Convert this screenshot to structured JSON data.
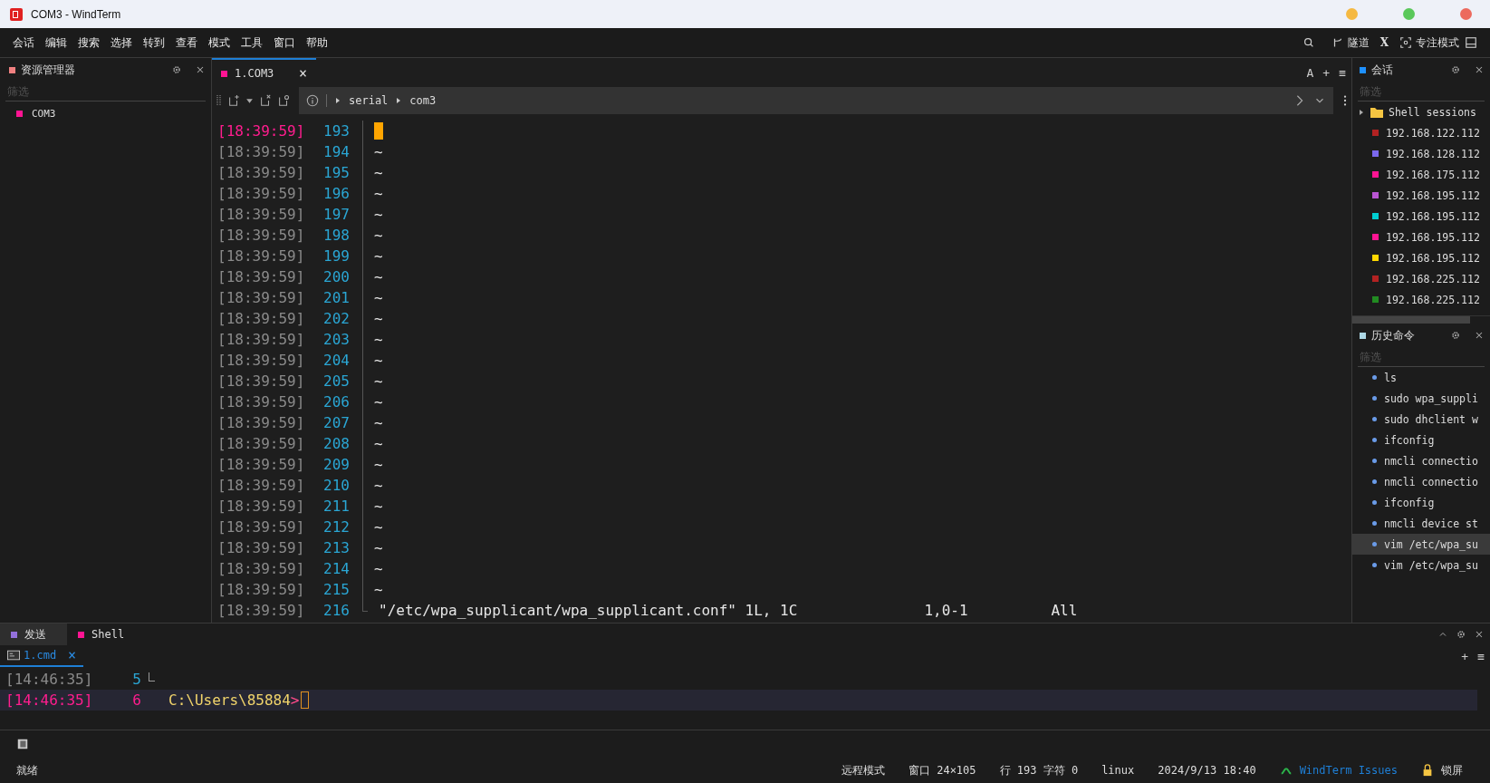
{
  "window": {
    "title": "COM3 - WindTerm"
  },
  "menu": [
    "会话",
    "编辑",
    "搜索",
    "选择",
    "转到",
    "查看",
    "模式",
    "工具",
    "窗口",
    "帮助"
  ],
  "menu_right": {
    "tunnel": "隧道",
    "x": "X",
    "focus": "专注模式"
  },
  "explorer": {
    "title": "资源管理器",
    "filter_placeholder": "筛选",
    "items": [
      {
        "label": "COM3",
        "color": "#ff1493"
      }
    ]
  },
  "editor_tabs": [
    {
      "label": "1.COM3",
      "selected": true,
      "color": "#ff1493",
      "close": "×"
    }
  ],
  "editor_actions": {
    "font": "A",
    "add": "+",
    "menu": "≡"
  },
  "breadcrumbs": [
    "serial",
    "com3"
  ],
  "terminal": {
    "rows": [
      {
        "time": "[18:39:59]",
        "num": "193",
        "text": "",
        "current": true
      },
      {
        "time": "[18:39:59]",
        "num": "194",
        "text": "~",
        "current": false
      },
      {
        "time": "[18:39:59]",
        "num": "195",
        "text": "~",
        "current": false
      },
      {
        "time": "[18:39:59]",
        "num": "196",
        "text": "~",
        "current": false
      },
      {
        "time": "[18:39:59]",
        "num": "197",
        "text": "~",
        "current": false
      },
      {
        "time": "[18:39:59]",
        "num": "198",
        "text": "~",
        "current": false
      },
      {
        "time": "[18:39:59]",
        "num": "199",
        "text": "~",
        "current": false
      },
      {
        "time": "[18:39:59]",
        "num": "200",
        "text": "~",
        "current": false
      },
      {
        "time": "[18:39:59]",
        "num": "201",
        "text": "~",
        "current": false
      },
      {
        "time": "[18:39:59]",
        "num": "202",
        "text": "~",
        "current": false
      },
      {
        "time": "[18:39:59]",
        "num": "203",
        "text": "~",
        "current": false
      },
      {
        "time": "[18:39:59]",
        "num": "204",
        "text": "~",
        "current": false
      },
      {
        "time": "[18:39:59]",
        "num": "205",
        "text": "~",
        "current": false
      },
      {
        "time": "[18:39:59]",
        "num": "206",
        "text": "~",
        "current": false
      },
      {
        "time": "[18:39:59]",
        "num": "207",
        "text": "~",
        "current": false
      },
      {
        "time": "[18:39:59]",
        "num": "208",
        "text": "~",
        "current": false
      },
      {
        "time": "[18:39:59]",
        "num": "209",
        "text": "~",
        "current": false
      },
      {
        "time": "[18:39:59]",
        "num": "210",
        "text": "~",
        "current": false
      },
      {
        "time": "[18:39:59]",
        "num": "211",
        "text": "~",
        "current": false
      },
      {
        "time": "[18:39:59]",
        "num": "212",
        "text": "~",
        "current": false
      },
      {
        "time": "[18:39:59]",
        "num": "213",
        "text": "~",
        "current": false
      },
      {
        "time": "[18:39:59]",
        "num": "214",
        "text": "~",
        "current": false
      },
      {
        "time": "[18:39:59]",
        "num": "215",
        "text": "~",
        "current": false
      },
      {
        "time": "[18:39:59]",
        "num": "216",
        "text": "\"/etc/wpa_supplicant/wpa_supplicant.conf\" 1L, 1C",
        "pos": "1,0-1",
        "scroll": "All",
        "current": false
      }
    ]
  },
  "sessions": {
    "title": "会话",
    "filter_placeholder": "筛选",
    "folder": {
      "label": "Shell sessions",
      "expanded": false
    },
    "items": [
      {
        "label": "192.168.122.112",
        "color": "#b22222"
      },
      {
        "label": "192.168.128.112",
        "color": "#7b68ee"
      },
      {
        "label": "192.168.175.112",
        "color": "#ff1493"
      },
      {
        "label": "192.168.195.112",
        "color": "#ba55d3"
      },
      {
        "label": "192.168.195.112",
        "color": "#00ced1"
      },
      {
        "label": "192.168.195.112",
        "color": "#ff1493"
      },
      {
        "label": "192.168.195.112",
        "color": "#ffd700"
      },
      {
        "label": "192.168.225.112",
        "color": "#b22222"
      },
      {
        "label": "192.168.225.112",
        "color": "#228b22"
      }
    ]
  },
  "history": {
    "title": "历史命令",
    "filter_placeholder": "筛选",
    "items": [
      {
        "label": "ls",
        "selected": false
      },
      {
        "label": "sudo wpa_suppli",
        "selected": false
      },
      {
        "label": "sudo dhclient w",
        "selected": false
      },
      {
        "label": "ifconfig",
        "selected": false
      },
      {
        "label": "nmcli connectio",
        "selected": false
      },
      {
        "label": "nmcli connectio",
        "selected": false
      },
      {
        "label": "ifconfig",
        "selected": false
      },
      {
        "label": "nmcli device st",
        "selected": false
      },
      {
        "label": "vim /etc/wpa_su",
        "selected": true
      },
      {
        "label": "vim /etc/wpa_su",
        "selected": false
      }
    ]
  },
  "bottom_tabs": [
    {
      "label": "发送",
      "selected": true,
      "color": "#9370db"
    },
    {
      "label": "Shell",
      "selected": false,
      "color": "#ff1493"
    }
  ],
  "shell_tabs": [
    {
      "label": "1.cmd",
      "selected": true,
      "close": "×"
    }
  ],
  "shell_actions": {
    "add": "+",
    "menu": "≡"
  },
  "shell": {
    "rows": [
      {
        "time": "[14:46:35]",
        "num": "5",
        "text": "",
        "current": false
      },
      {
        "time": "[14:46:35]",
        "num": "6",
        "text": "C:\\Users\\85884",
        "prompt": ">",
        "current": true
      }
    ]
  },
  "status_bar": {
    "ready": "就绪",
    "items": [
      "远程模式",
      "窗口 24×105",
      "行 193 字符 0",
      "linux",
      "2024/9/13 18:40"
    ],
    "link": "WindTerm Issues",
    "lock": "锁屏"
  }
}
